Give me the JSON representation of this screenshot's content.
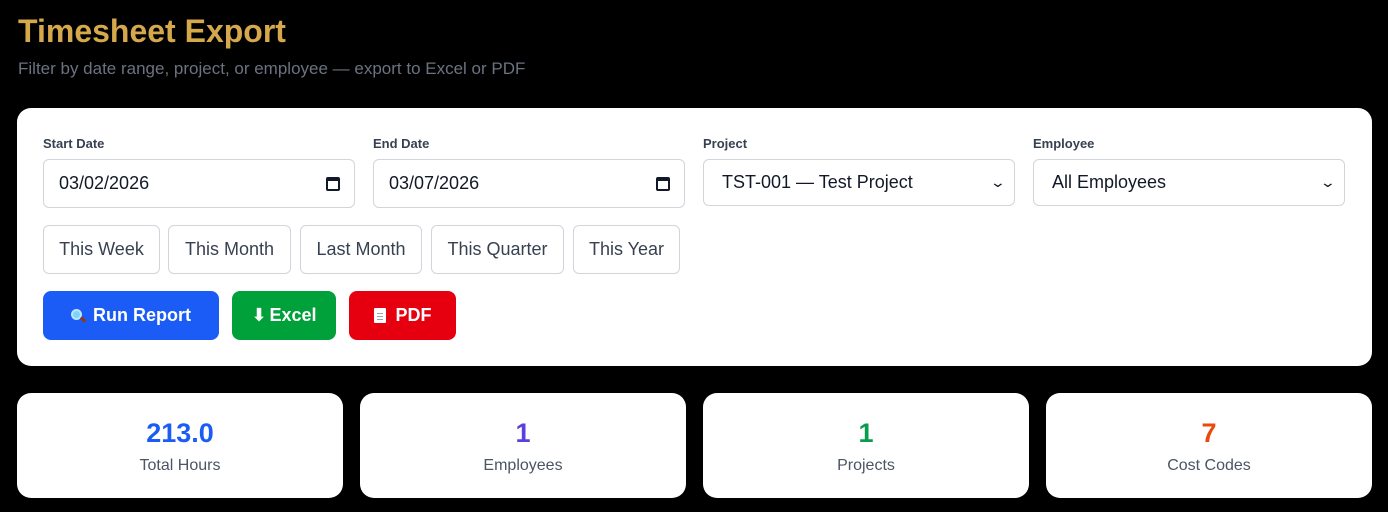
{
  "header": {
    "title": "Timesheet Export",
    "subtitle": "Filter by date range, project, or employee — export to Excel or PDF"
  },
  "filters": {
    "start_date": {
      "label": "Start Date",
      "value": "03/02/2026",
      "icon": "calendar-icon"
    },
    "end_date": {
      "label": "End Date",
      "value": "03/07/2026",
      "icon": "calendar-icon"
    },
    "project": {
      "label": "Project",
      "value": "TST-001 — Test Project",
      "icon": "chevron-down-icon"
    },
    "employee": {
      "label": "Employee",
      "value": "All Employees",
      "icon": "chevron-down-icon"
    }
  },
  "presets": [
    "This Week",
    "This Month",
    "Last Month",
    "This Quarter",
    "This Year"
  ],
  "actions": {
    "run_report": {
      "label": "Run Report",
      "icon": "magnifier-icon",
      "color": "#1a5cf5"
    },
    "excel": {
      "label": "Excel",
      "icon": "down-arrow-icon",
      "color": "#00a03a"
    },
    "pdf": {
      "label": "PDF",
      "icon": "document-icon",
      "color": "#e6000f"
    }
  },
  "stats": [
    {
      "value": "213.0",
      "label": "Total Hours",
      "color": "#1a5cf5"
    },
    {
      "value": "1",
      "label": "Employees",
      "color": "#5b3fe0"
    },
    {
      "value": "1",
      "label": "Projects",
      "color": "#0b9b4f"
    },
    {
      "value": "7",
      "label": "Cost Codes",
      "color": "#ea4a0c"
    }
  ],
  "colors": {
    "background": "#000000",
    "title": "#d4a84b",
    "subtitle": "#6b7280",
    "card": "#ffffff"
  }
}
